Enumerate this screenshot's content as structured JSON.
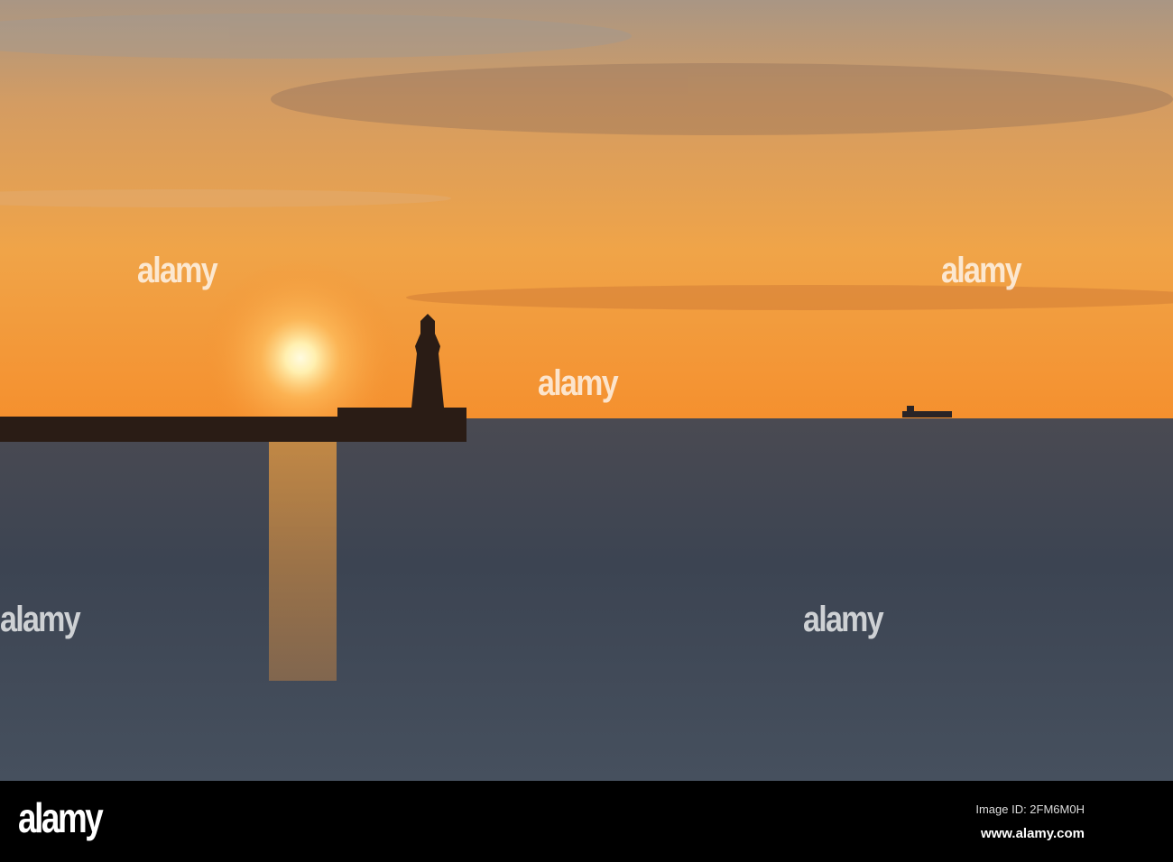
{
  "photo": {
    "subject": "lighthouse-sunset-seascape",
    "colors": {
      "sky_top": "#b9926e",
      "sky_mid": "#f1a246",
      "horizon": "#f5952f",
      "sun": "#fff6d0",
      "sea": "#3c4350",
      "silhouette": "#2a1c15"
    }
  },
  "watermark": {
    "text": "alamy"
  },
  "footer": {
    "logo": "alamy",
    "image_id": "Image ID: 2FM6M0H",
    "website": "www.alamy.com"
  }
}
